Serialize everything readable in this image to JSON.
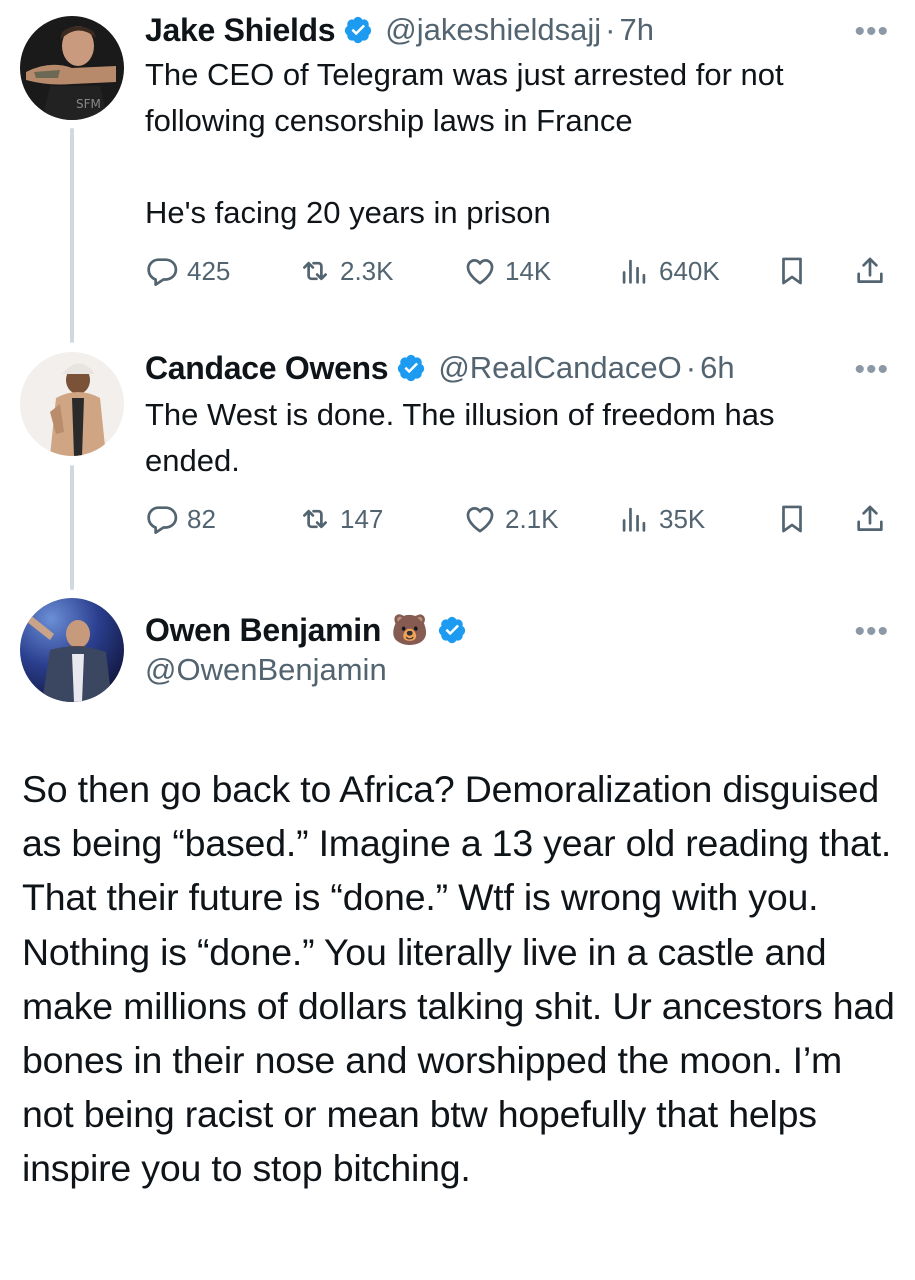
{
  "tweets": [
    {
      "name": "Jake Shields",
      "handle": "@jakeshieldsajj",
      "time": "7h",
      "text": "The CEO of Telegram was just arrested for not following censorship laws in France\n\nHe's facing 20 years in prison",
      "replies": "425",
      "reposts": "2.3K",
      "likes": "14K",
      "views": "640K"
    },
    {
      "name": "Candace Owens",
      "handle": "@RealCandaceO",
      "time": "6h",
      "text": "The West is done. The illusion of freedom has ended.",
      "replies": "82",
      "reposts": "147",
      "likes": "2.1K",
      "views": "35K"
    }
  ],
  "main": {
    "name": "Owen Benjamin",
    "emoji": "🐻",
    "handle": "@OwenBenjamin",
    "text": "So then go back to Africa? Demoralization disguised as being “based.” Imagine a 13 year old reading that. That their future is “done.” Wtf is wrong with you.\nNothing is “done.” You literally live in a castle and make millions of dollars talking shit. Ur ancestors had bones in their nose and worshipped the moon. I’m not being racist or mean btw hopefully that helps inspire you to stop bitching."
  },
  "more_glyph": "•••",
  "dot": "·",
  "colors": {
    "verified": "#1d9bf0",
    "secondary_text": "#536471",
    "thread_line": "#cfd9de"
  }
}
